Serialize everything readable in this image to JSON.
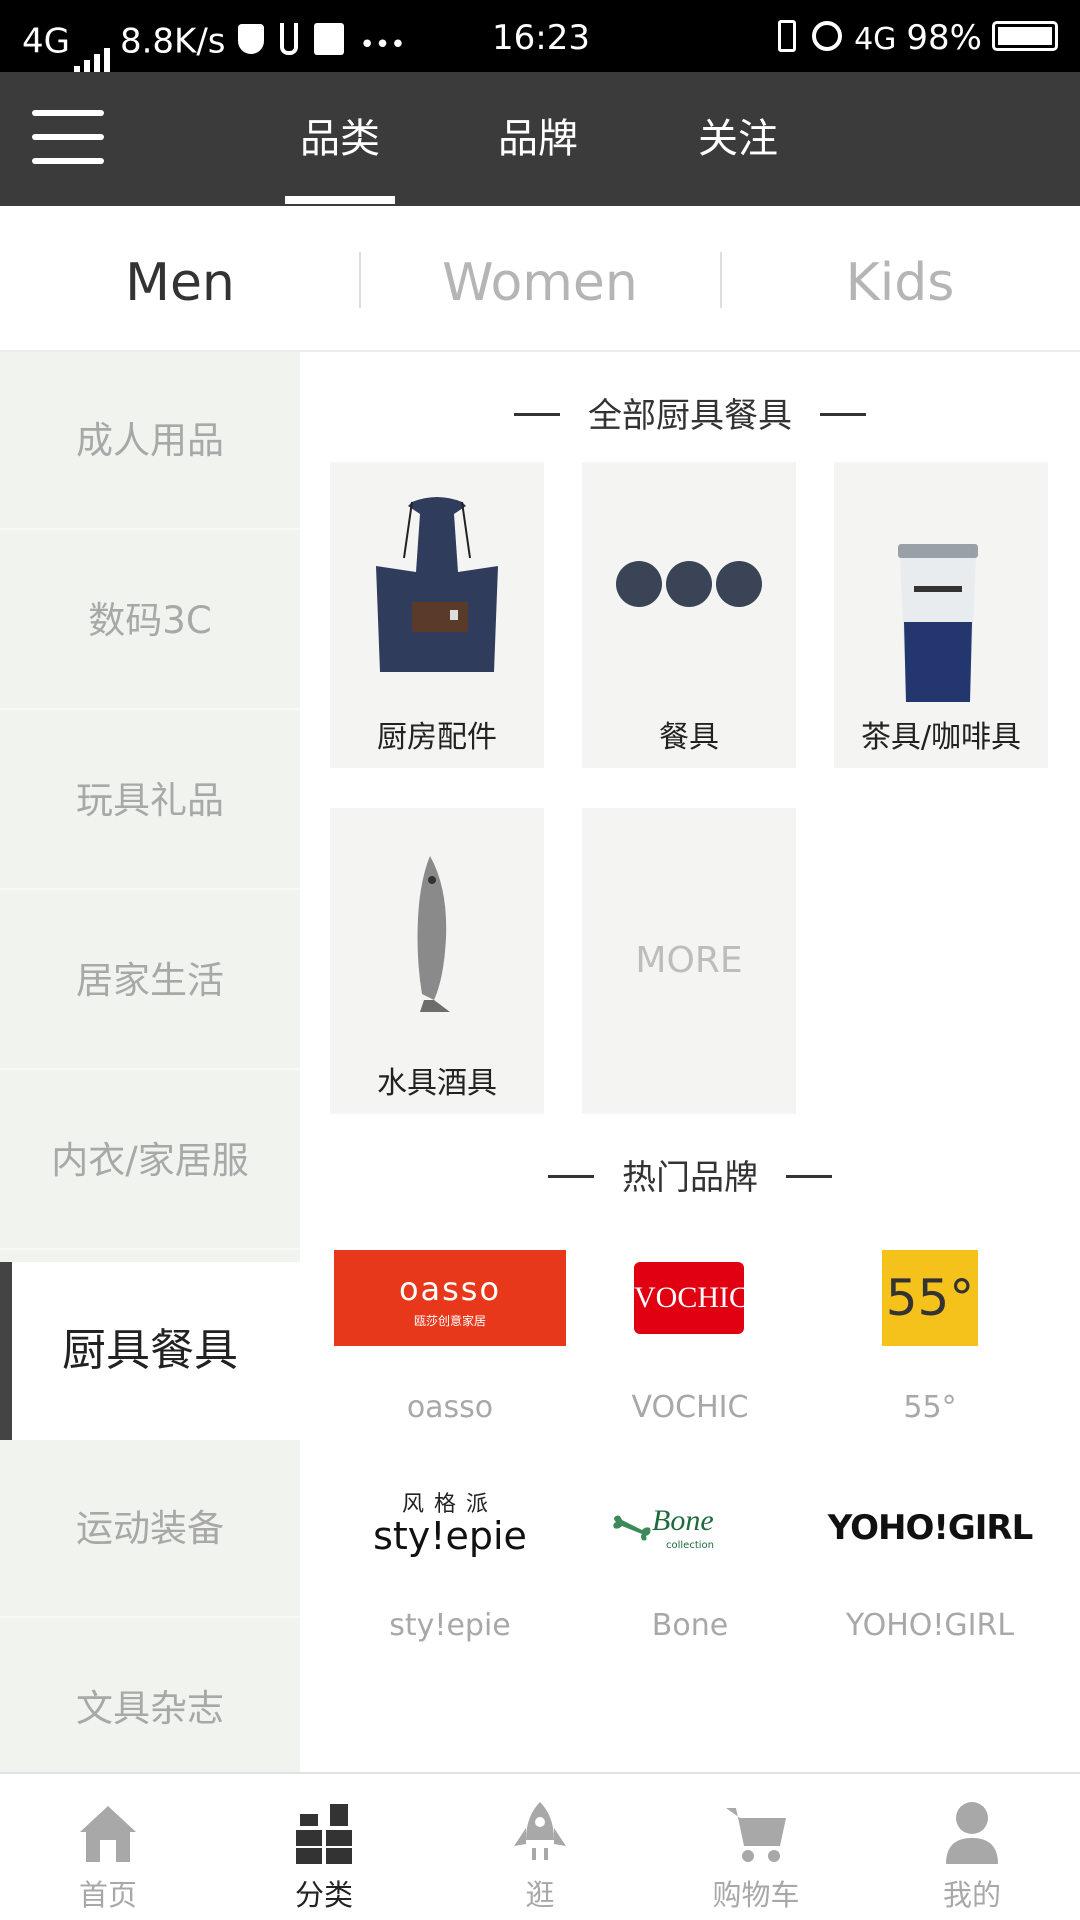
{
  "status_bar": {
    "network": "4G",
    "speed": "8.8K/s",
    "more": "•••",
    "time": "16:23",
    "network_right": "4G",
    "battery": "98%"
  },
  "top_nav": {
    "tabs": [
      {
        "label": "品类",
        "active": true
      },
      {
        "label": "品牌",
        "active": false
      },
      {
        "label": "关注",
        "active": false
      }
    ]
  },
  "gender_tabs": [
    {
      "label": "Men",
      "active": true
    },
    {
      "label": "Women",
      "active": false
    },
    {
      "label": "Kids",
      "active": false
    }
  ],
  "sidebar": {
    "items": [
      {
        "label": "成人用品"
      },
      {
        "label": "数码3C"
      },
      {
        "label": "玩具礼品"
      },
      {
        "label": "居家生活"
      },
      {
        "label": "内衣/家居服"
      },
      {
        "label": "厨具餐具",
        "active": true
      },
      {
        "label": "运动装备"
      },
      {
        "label": "文具杂志"
      }
    ]
  },
  "main": {
    "all_title": "全部厨具餐具",
    "categories": [
      {
        "label": "厨房配件",
        "icon": "apron-image"
      },
      {
        "label": "餐具",
        "icon": "plates-image"
      },
      {
        "label": "茶具/咖啡具",
        "icon": "tumbler-image"
      },
      {
        "label": "水具酒具",
        "icon": "fish-opener-image"
      }
    ],
    "more_label": "MORE",
    "brands_title": "热门品牌",
    "brands": [
      {
        "name": "oasso",
        "logo_text": "oasso",
        "logo_sub": "瓯莎创意家居",
        "color": "#e8381c"
      },
      {
        "name": "VOCHIC",
        "logo_text": "VOCHIC",
        "color": "#e00012"
      },
      {
        "name": "55°",
        "logo_text": "55°",
        "color": "#f5c21b"
      },
      {
        "name": "sty!epie",
        "logo_text": "sty!epie",
        "logo_sub": "风格派"
      },
      {
        "name": "Bone",
        "logo_text": "Bone",
        "logo_sub": "collection"
      },
      {
        "name": "YOHO!GIRL",
        "logo_text": "YOHO!GIRL"
      }
    ]
  },
  "bottom_bar": {
    "items": [
      {
        "label": "首页",
        "icon": "home-icon"
      },
      {
        "label": "分类",
        "icon": "category-icon",
        "active": true
      },
      {
        "label": "逛",
        "icon": "rocket-icon"
      },
      {
        "label": "购物车",
        "icon": "cart-icon"
      },
      {
        "label": "我的",
        "icon": "user-icon"
      }
    ]
  }
}
